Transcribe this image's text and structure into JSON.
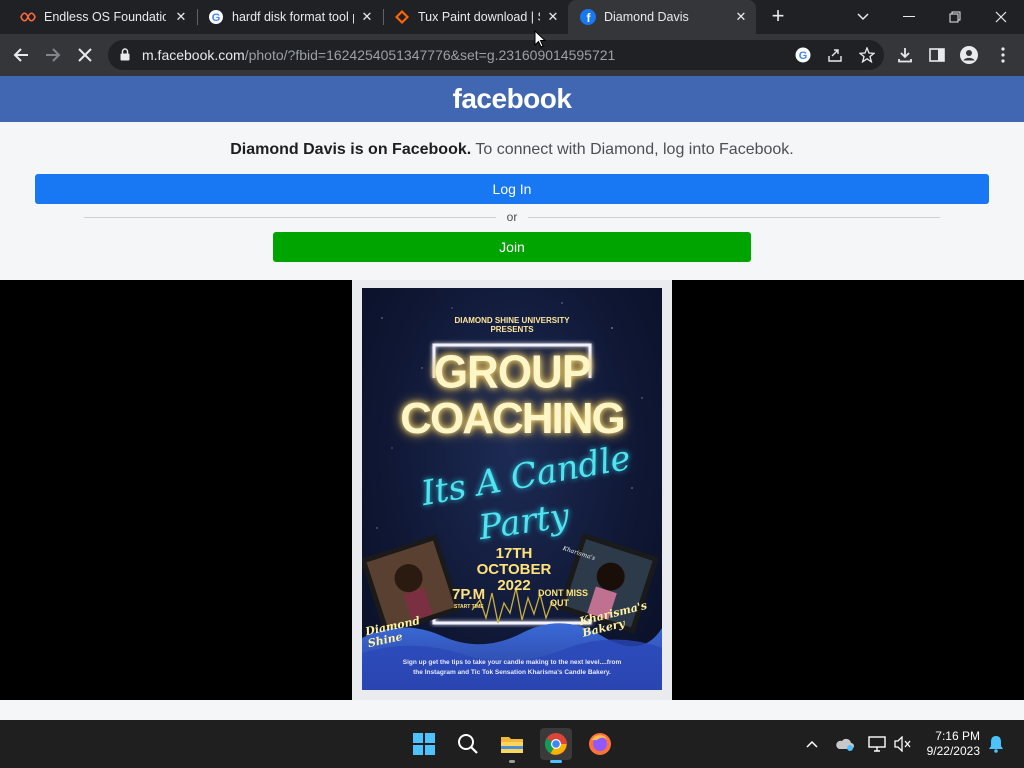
{
  "tabs": [
    {
      "title": "Endless OS Foundation",
      "icon": "endless-icon",
      "active": false
    },
    {
      "title": "hardf disk format tool p",
      "icon": "google-icon",
      "active": false
    },
    {
      "title": "Tux Paint download | S",
      "icon": "sourceforge-icon",
      "active": false
    },
    {
      "title": "Diamond Davis",
      "icon": "facebook-icon",
      "active": true
    }
  ],
  "toolbar": {
    "url_host": "m.facebook.com",
    "url_path": "/photo/?fbid=1624254051347776&set=g.231609014595721"
  },
  "page": {
    "logo": "facebook",
    "message_bold": "Diamond Davis is on Facebook.",
    "message_rest": " To connect with Diamond, log into Facebook.",
    "login_label": "Log In",
    "or_label": "or",
    "join_label": "Join"
  },
  "poster": {
    "presenter": "DIAMOND SHINE UNIVERSITY",
    "presents": "PRESENTS",
    "title1": "GROUP",
    "title2": "COACHING",
    "script1": "Its A Candle",
    "script2": "Party",
    "date1": "17TH",
    "date2": "OCTOBER",
    "date3": "2022",
    "time": "7P.M",
    "start": "START TIME",
    "dont": "DONT MISS",
    "out": "OUT",
    "left_name": "Diamond Shine",
    "right_name": "Kharisma's Bakery",
    "right_top": "Kharisma's",
    "footer": "Sign up get the tips to take your candle making to the next level....from the Instagram and Tic Tok Sensation Kharisma's Candle Bakery."
  },
  "taskbar": {
    "time": "7:16 PM",
    "date": "9/22/2023"
  },
  "colors": {
    "facebook_blue": "#4267b2",
    "login_blue": "#1877f2",
    "join_green": "#00a400"
  }
}
